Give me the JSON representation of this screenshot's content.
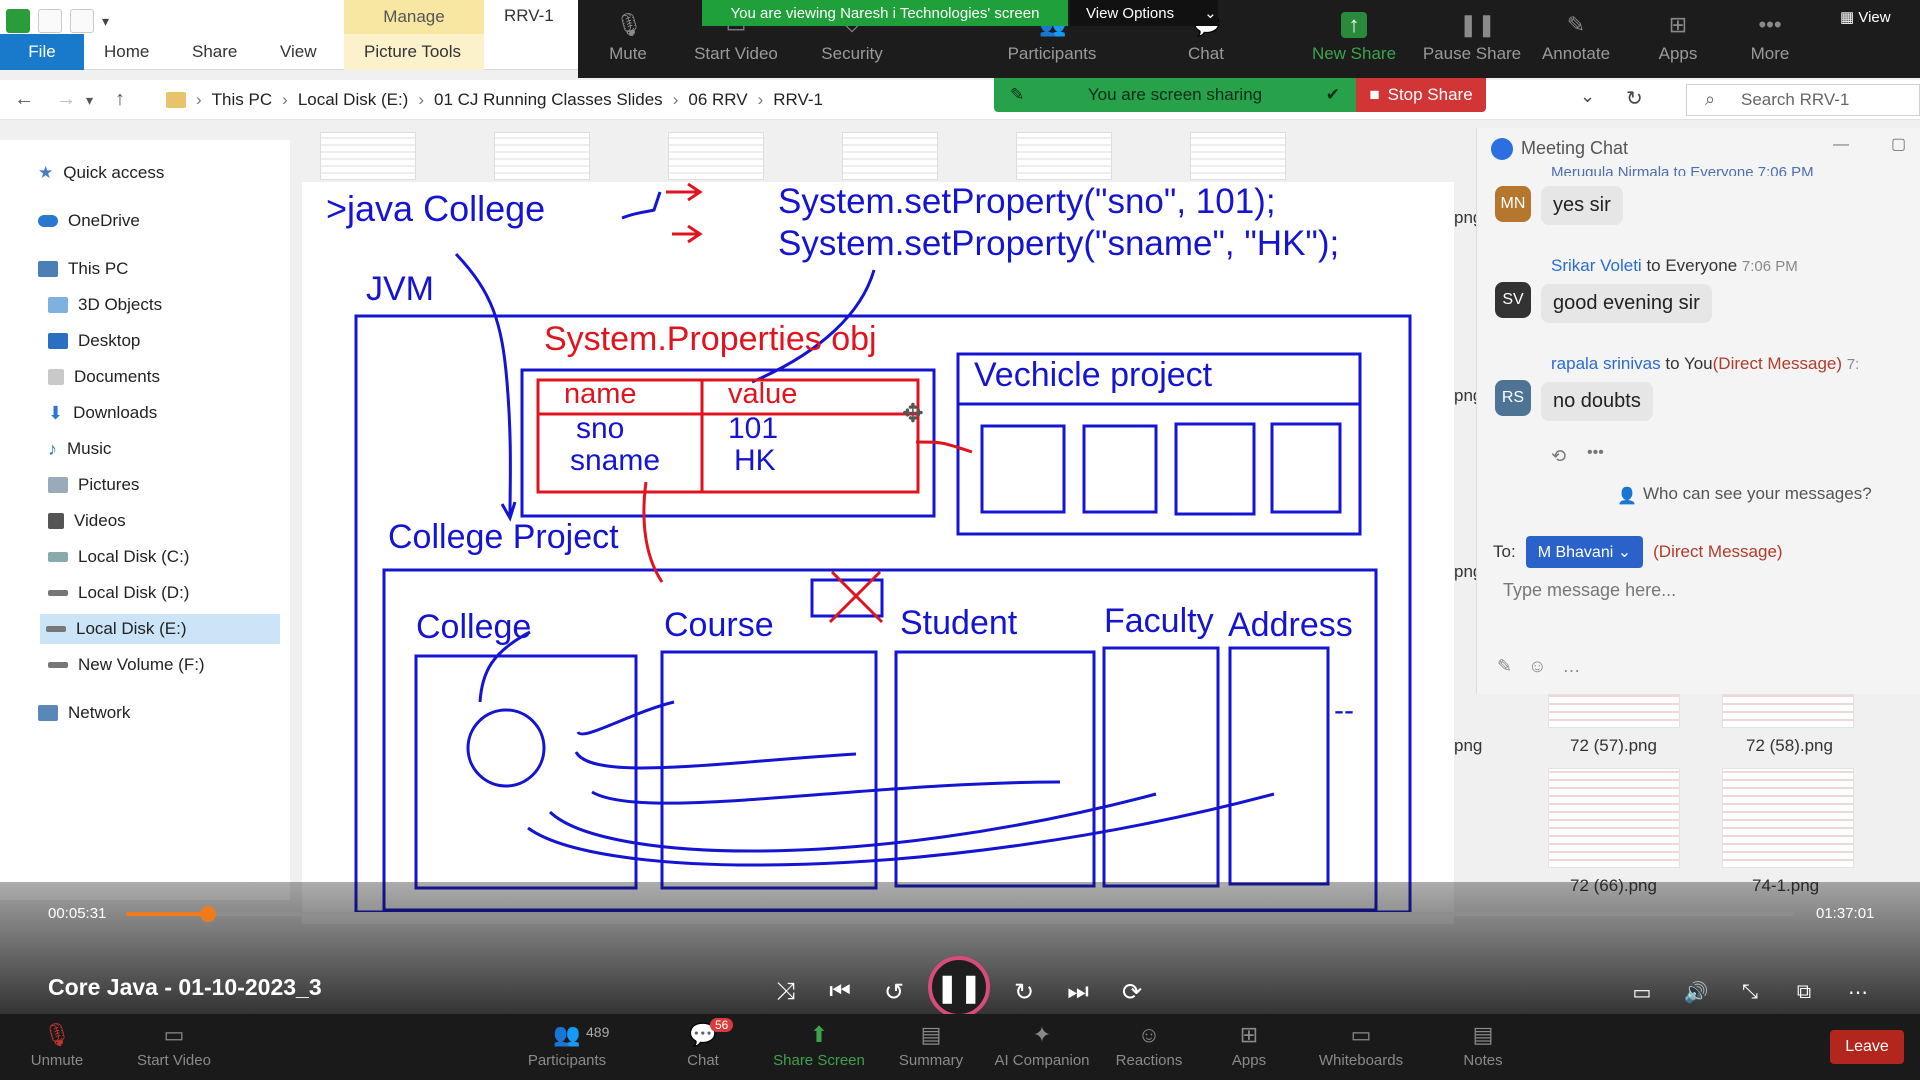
{
  "explorer": {
    "tabs": [
      "File",
      "Home",
      "Share",
      "View"
    ],
    "contextual_group": "Manage",
    "contextual_tab": "Picture Tools",
    "window_title": "RRV-1",
    "breadcrumb": [
      "This PC",
      "Local Disk (E:)",
      "01 CJ Running Classes Slides",
      "06 RRV",
      "RRV-1"
    ],
    "search_placeholder": "Search RRV-1",
    "sidebar": [
      {
        "label": "Quick access",
        "icon": "star-icon"
      },
      {
        "label": "OneDrive",
        "icon": "cloud-icon"
      },
      {
        "label": "This PC",
        "icon": "computer-icon"
      },
      {
        "label": "3D Objects",
        "icon": "cube-icon"
      },
      {
        "label": "Desktop",
        "icon": "desktop-icon"
      },
      {
        "label": "Documents",
        "icon": "document-icon"
      },
      {
        "label": "Downloads",
        "icon": "download-icon"
      },
      {
        "label": "Music",
        "icon": "music-icon"
      },
      {
        "label": "Pictures",
        "icon": "picture-icon"
      },
      {
        "label": "Videos",
        "icon": "video-icon"
      },
      {
        "label": "Local Disk (C:)",
        "icon": "drive-icon"
      },
      {
        "label": "Local Disk (D:)",
        "icon": "drive-icon"
      },
      {
        "label": "Local Disk (E:)",
        "icon": "drive-icon"
      },
      {
        "label": "New Volume (F:)",
        "icon": "drive-icon"
      },
      {
        "label": "Network",
        "icon": "network-icon"
      }
    ],
    "files": [
      "png",
      "png",
      "png",
      "png",
      "72 (57).png",
      "72 (58).png",
      "72 (66).png",
      "74-1.png"
    ]
  },
  "zoom_top": {
    "viewing_banner": "You are viewing Naresh i Technologies' screen",
    "view_options": "View Options",
    "items": [
      "Mute",
      "Start Video",
      "Security",
      "Participants",
      "Chat",
      "New Share",
      "Pause Share",
      "Annotate",
      "Apps",
      "More"
    ],
    "sharing_banner": "You are screen sharing",
    "stop_share": "Stop Share",
    "view_label": "View"
  },
  "chat": {
    "title": "Meeting Chat",
    "truncated_header": "Merugula Nirmala to Everyone 7:06 PM",
    "messages": [
      {
        "avatar": "MN",
        "text": "yes sir"
      },
      {
        "sender": "Srikar Voleti",
        "to": "to Everyone",
        "time": "7:06 PM",
        "avatar": "SV",
        "text": "good evening sir"
      },
      {
        "sender": "rapala srinivas",
        "to": "to You",
        "dm": "(Direct Message)",
        "time": "7:",
        "avatar": "RS",
        "text": "no doubts"
      }
    ],
    "who_can_see": "Who can see your messages?",
    "to_label": "To:",
    "recipient": "M Bhavani",
    "recipient_dm": "(Direct Message)",
    "input_placeholder": "Type message here..."
  },
  "slide": {
    "cmd": ">java College",
    "prop1": "System.setProperty(\"sno\", 101);",
    "prop2": "System.setProperty(\"sname\", \"HK\");",
    "jvm": "JVM",
    "props_title": "System.Properties obj",
    "col_name": "name",
    "col_value": "value",
    "keys": [
      "sno",
      "sname"
    ],
    "values": [
      "101",
      "HK"
    ],
    "vehicle": "Vechicle  project",
    "college_project": "College Project",
    "classes": [
      "College",
      "Course",
      "Student",
      "Faculty",
      "Address"
    ],
    "dashes": "--"
  },
  "player": {
    "elapsed": "00:05:31",
    "total": "01:37:01",
    "progress": 0.049,
    "title": "Core Java - 01-10-2023_3"
  },
  "zoom_bottom": {
    "items": [
      "Unmute",
      "Start Video",
      "Participants",
      "Chat",
      "Share Screen",
      "Summary",
      "AI Companion",
      "Reactions",
      "Apps",
      "Whiteboards",
      "Notes"
    ],
    "participants_count": "489",
    "chat_badge": "56",
    "leave": "Leave"
  }
}
